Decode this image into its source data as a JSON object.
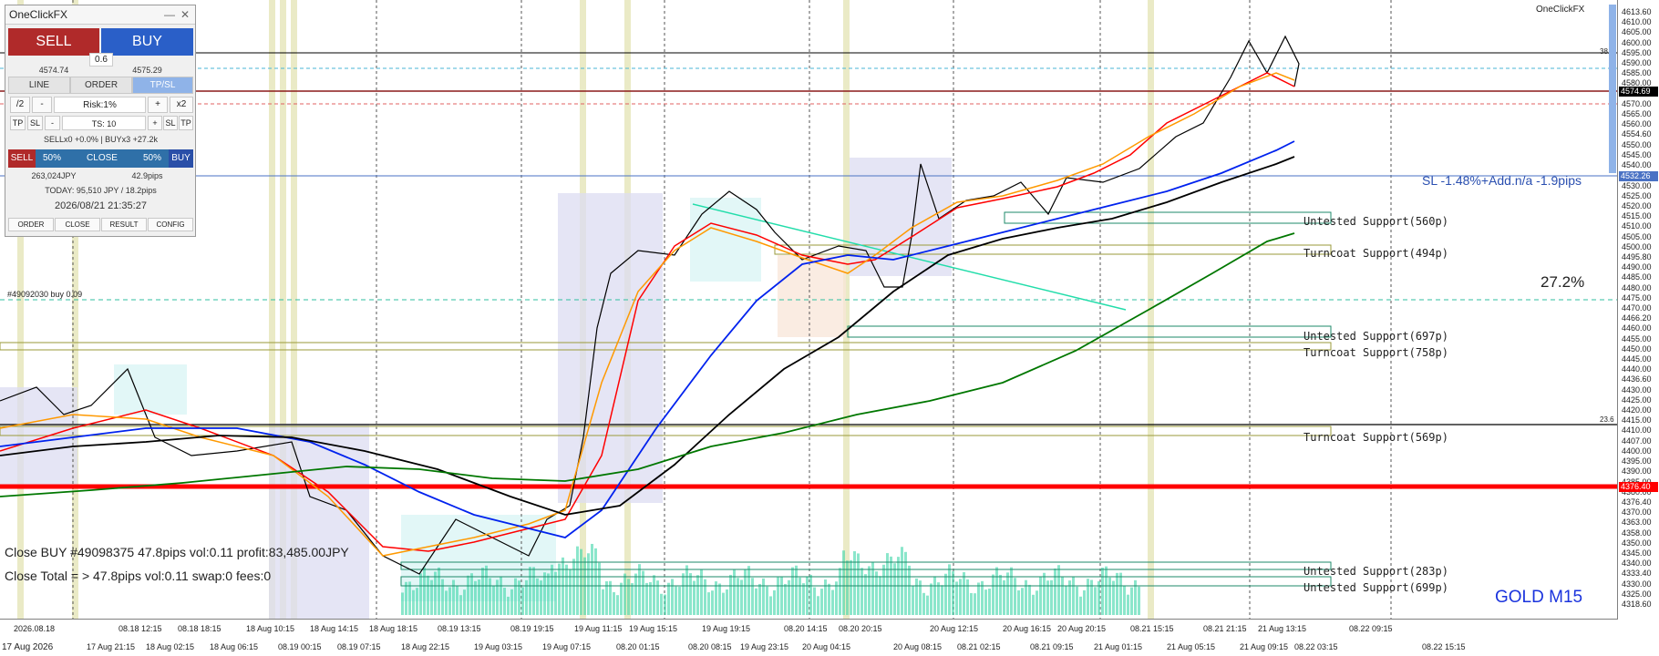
{
  "panel": {
    "title": "OneClickFX",
    "sell_label": "SELL",
    "buy_label": "BUY",
    "spread": "0.6",
    "bid": "4574.74",
    "ask": "4575.29",
    "mode_tabs": [
      "LINE",
      "ORDER",
      "TP/SL"
    ],
    "half_label": "/2",
    "minus_label": "-",
    "risk_label": "Risk:1%",
    "plus_label": "+",
    "double_label": "x2",
    "tp_label": "TP",
    "sl_label": "SL",
    "ts_label": "TS: 10",
    "position_summary": "SELLx0 +0.0% | BUYx3 +27.2k",
    "close_sell": "SELL",
    "close_50a": "50%",
    "close_all": "CLOSE",
    "close_50b": "50%",
    "close_buy": "BUY",
    "profit_jpy": "263,024JPY",
    "profit_pips": "42.9pips",
    "today": "TODAY: 95,510 JPY / 18.2pips",
    "datetime": "2026/08/21 21:35:27",
    "bottom_tabs": [
      "ORDER",
      "CLOSE",
      "RESULT",
      "CONFIG"
    ]
  },
  "chart": {
    "symbol": "GOLD M15",
    "indicator_name": "OneClickFX",
    "order_label": "#49092030 buy 0.09",
    "sl_label": "SL -1.48%+Add.n/a -1.9pips",
    "pct_label": "27.2%",
    "close_buy_text": "Close BUY #49098375 47.8pips vol:0.11 profit:83,485.00JPY",
    "close_total_text": "Close Total = > 47.8pips vol:0.11 swap:0 fees:0",
    "fib_382": "38.2",
    "fib_236": "23.6",
    "zones": [
      "Untested Support(560p)",
      "Turncoat Support(494p)",
      "Untested Support(697p)",
      "Turncoat Support(758p)",
      "Turncoat Support(569p)",
      "Untested Support(283p)",
      "Untested Support(699p)"
    ]
  },
  "price_axis": {
    "ticks": [
      "4613.60",
      "4610.00",
      "4605.00",
      "4600.00",
      "4595.00",
      "4590.00",
      "4585.00",
      "4580.00",
      "4575.00",
      "4570.00",
      "4565.00",
      "4560.00",
      "4554.60",
      "4550.00",
      "4545.00",
      "4540.00",
      "4535.00",
      "4530.00",
      "4525.00",
      "4520.00",
      "4515.00",
      "4510.00",
      "4505.00",
      "4500.00",
      "4495.80",
      "4490.00",
      "4485.00",
      "4480.00",
      "4475.00",
      "4470.00",
      "4466.20",
      "4460.00",
      "4455.00",
      "4450.00",
      "4445.00",
      "4440.00",
      "4436.60",
      "4430.00",
      "4425.00",
      "4420.00",
      "4415.00",
      "4410.00",
      "4407.00",
      "4400.00",
      "4395.00",
      "4390.00",
      "4385.00",
      "4380.00",
      "4376.40",
      "4370.00",
      "4363.00",
      "4358.00",
      "4350.00",
      "4345.00",
      "4340.00",
      "4333.40",
      "4330.00",
      "4325.00",
      "4318.60"
    ],
    "current_price": "4574.69",
    "sl_price": "4532.26",
    "red_level": "4376.40",
    "current_color": "#000000",
    "sl_color": "#4a72c4",
    "red_color": "#ff0000"
  },
  "time_axis": {
    "labels": [
      "2026.08.18",
      "17 Aug 21:15",
      "08.18 12:15",
      "18 Aug 02:15",
      "08.18 18:15",
      "18 Aug 06:15",
      "18 Aug 10:15",
      "08.19 00:15",
      "18 Aug 14:15",
      "08.19 07:15",
      "18 Aug 18:15",
      "18 Aug 22:15",
      "08.19 13:15",
      "19 Aug 03:15",
      "08.19 19:15",
      "19 Aug 07:15",
      "19 Aug 11:15",
      "08.20 01:15",
      "19 Aug 15:15",
      "08.20 08:15",
      "19 Aug 19:15",
      "19 Aug 23:15",
      "08.20 14:15",
      "20 Aug 04:15",
      "08.20 20:15",
      "20 Aug 08:15",
      "20 Aug 12:15",
      "08.21 02:15",
      "20 Aug 16:15",
      "08.21 09:15",
      "20 Aug 20:15",
      "21 Aug 01:15",
      "08.21 15:15",
      "21 Aug 05:15",
      "08.21 21:15",
      "21 Aug 09:15",
      "21 Aug 13:15",
      "08.22 03:15",
      "08.22 09:15",
      "08.22 15:15"
    ],
    "first_label": "17 Aug 2026"
  },
  "colors": {
    "ema_fast": "#ff0000",
    "ema_mid": "#ff9900",
    "sma_blue": "#0022ee",
    "sma_black": "#000000",
    "sma_green": "#007700",
    "volume": "#3ed6a8",
    "trend": "#22ddaa",
    "zone_border": "#1e8a6a",
    "zone_olive": "#9a9a3a",
    "session": "#e8e8c0",
    "symbol": "#1a33dd"
  }
}
